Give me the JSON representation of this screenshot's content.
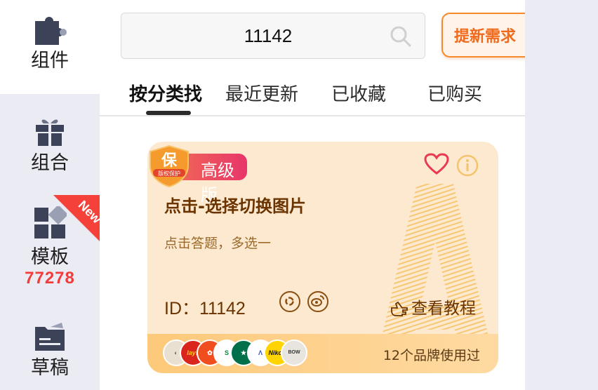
{
  "sidebar": {
    "items": [
      {
        "label": "组件",
        "icon": "puzzle-icon",
        "active": true
      },
      {
        "label": "组合",
        "icon": "gift-icon"
      },
      {
        "label": "模板",
        "icon": "template-grid-icon",
        "badge": "New",
        "count": "77278"
      },
      {
        "label": "草稿",
        "icon": "draft-folder-icon"
      }
    ]
  },
  "search": {
    "value": "11142",
    "icon": "search-icon"
  },
  "header": {
    "request_button": "提新需求"
  },
  "tabs": [
    {
      "label": "按分类找",
      "active": true
    },
    {
      "label": "最近更新"
    },
    {
      "label": "已收藏"
    },
    {
      "label": "已购买"
    }
  ],
  "card": {
    "badge": "高级版",
    "shield_text": "保",
    "shield_sub": "版权保护",
    "title": "点击-选择切换图片",
    "subtitle": "点击答题，多选一",
    "id_label": "ID：11142",
    "tutorial_label": "查看教程",
    "brand_count": "12个品牌使用过",
    "brands": [
      "brand-logo-1",
      "lays-logo",
      "brand-logo-3",
      "subway-logo",
      "starbucks-logo",
      "brand-logo-6",
      "nikon-logo",
      "bowmore-logo"
    ],
    "colors": {
      "bg": "#fde9cf",
      "accent": "#e8356a",
      "text": "#6b3300"
    }
  }
}
